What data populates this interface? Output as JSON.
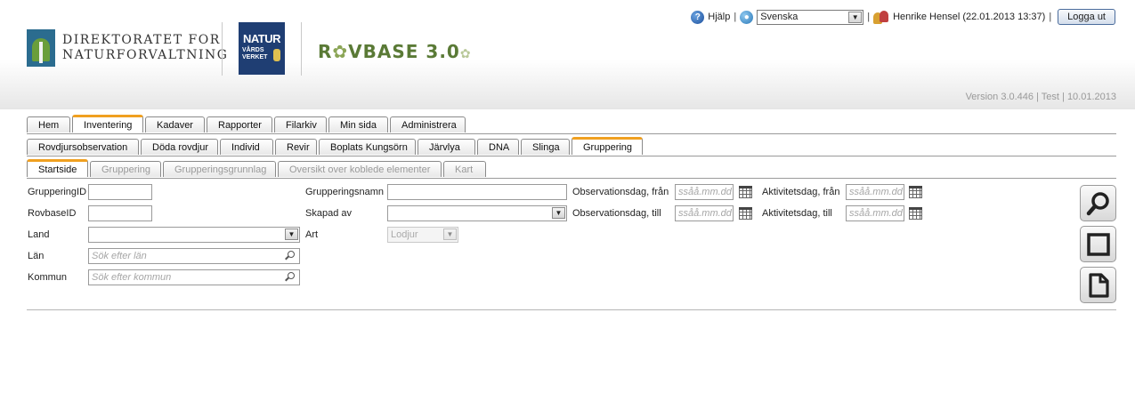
{
  "header": {
    "org_logo_lines": [
      "DIREKTORATET FOR",
      "NATURFORVALTNING"
    ],
    "nv_logo_line1": "NATUR",
    "nv_logo_line2": [
      "VÅRDS",
      "VERKET"
    ],
    "app_logo": {
      "pre": "R",
      "paw": "✿",
      "post": "VBASE 3.0",
      "trail": "✿"
    },
    "help_label": "Hjälp",
    "separator": "|",
    "language": "Svenska",
    "user": "Henrike Hensel (22.01.2013 13:37)",
    "logout_label": "Logga ut",
    "version": "Version 3.0.446 | Test | 10.01.2013"
  },
  "main_tabs": [
    {
      "label": "Hem"
    },
    {
      "label": "Inventering",
      "active": true
    },
    {
      "label": "Kadaver"
    },
    {
      "label": "Rapporter"
    },
    {
      "label": "Filarkiv"
    },
    {
      "label": "Min sida"
    },
    {
      "label": "Administrera"
    }
  ],
  "sub_tabs": [
    {
      "label": "Rovdjursobservation"
    },
    {
      "label": "Döda rovdjur"
    },
    {
      "label": "Individ"
    },
    {
      "label": "Revir"
    },
    {
      "label": "Boplats Kungsörn"
    },
    {
      "label": "Järvlya"
    },
    {
      "label": "DNA"
    },
    {
      "label": "Slinga"
    },
    {
      "label": "Gruppering",
      "active": true
    }
  ],
  "view_tabs": [
    {
      "label": "Startside",
      "active": true
    },
    {
      "label": "Gruppering",
      "disabled": true
    },
    {
      "label": "Grupperingsgrunnlag",
      "disabled": true
    },
    {
      "label": "Oversikt over koblede elementer",
      "disabled": true
    },
    {
      "label": "Kart",
      "disabled": true
    }
  ],
  "form": {
    "gruppering_id_label": "GrupperingID",
    "gruppering_id_value": "",
    "rovbase_id_label": "RovbaseID",
    "rovbase_id_value": "",
    "land_label": "Land",
    "land_value": "",
    "lan_label": "Län",
    "lan_placeholder": "Sök efter län",
    "kommun_label": "Kommun",
    "kommun_placeholder": "Sök efter kommun",
    "grupperingsnamn_label": "Grupperingsnamn",
    "grupperingsnamn_value": "",
    "skapad_av_label": "Skapad av",
    "skapad_av_value": "",
    "art_label": "Art",
    "art_value": "Lodjur",
    "obs_fran_label": "Observationsdag, från",
    "obs_till_label": "Observationsdag, till",
    "akt_fran_label": "Aktivitetsdag, från",
    "akt_till_label": "Aktivitetsdag, till",
    "date_placeholder": "ssåå.mm.dd"
  },
  "colors": {
    "active_tab_accent": "#f0a020",
    "logo_green": "#5a7a36",
    "nv_blue": "#1f3e73"
  },
  "icons": [
    "help-icon",
    "globe-icon",
    "users-icon",
    "search-icon",
    "calendar-icon",
    "magnifier-icon",
    "square-icon",
    "document-icon"
  ]
}
